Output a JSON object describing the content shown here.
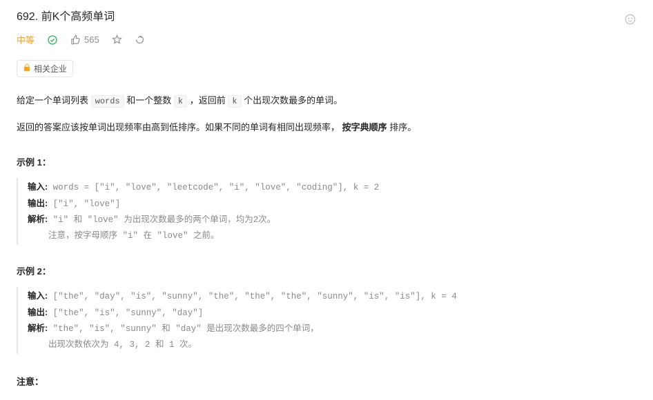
{
  "title": "692. 前K个高频单词",
  "difficulty": "中等",
  "likes": "565",
  "companies_tag": "相关企业",
  "description": {
    "part1": "给定一个单词列表 ",
    "code1": "words",
    "part2": " 和一个整数 ",
    "code2": "k",
    "part3": " ，返回前 ",
    "code3": "k",
    "part4": " 个出现次数最多的单词。"
  },
  "description2": {
    "part1": "返回的答案应该按单词出现频率由高到低排序。如果不同的单词有相同出现频率， ",
    "bold": "按字典顺序",
    "part2": " 排序。"
  },
  "example1": {
    "title": "示例 1：",
    "input_label": "输入:",
    "input_val": " words = [\"i\", \"love\", \"leetcode\", \"i\", \"love\", \"coding\"], k = 2",
    "output_label": "输出:",
    "output_val": " [\"i\", \"love\"]",
    "explain_label": "解析:",
    "explain_val": " \"i\" 和 \"love\" 为出现次数最多的两个单词，均为2次。\n    注意，按字母顺序 \"i\" 在 \"love\" 之前。"
  },
  "example2": {
    "title": "示例 2：",
    "input_label": "输入:",
    "input_val": " [\"the\", \"day\", \"is\", \"sunny\", \"the\", \"the\", \"the\", \"sunny\", \"is\", \"is\"], k = 4",
    "output_label": "输出:",
    "output_val": " [\"the\", \"is\", \"sunny\", \"day\"]",
    "explain_label": "解析:",
    "explain_val": " \"the\", \"is\", \"sunny\" 和 \"day\" 是出现次数最多的四个单词，\n    出现次数依次为 4, 3, 2 和 1 次。"
  },
  "note_title": "注意："
}
